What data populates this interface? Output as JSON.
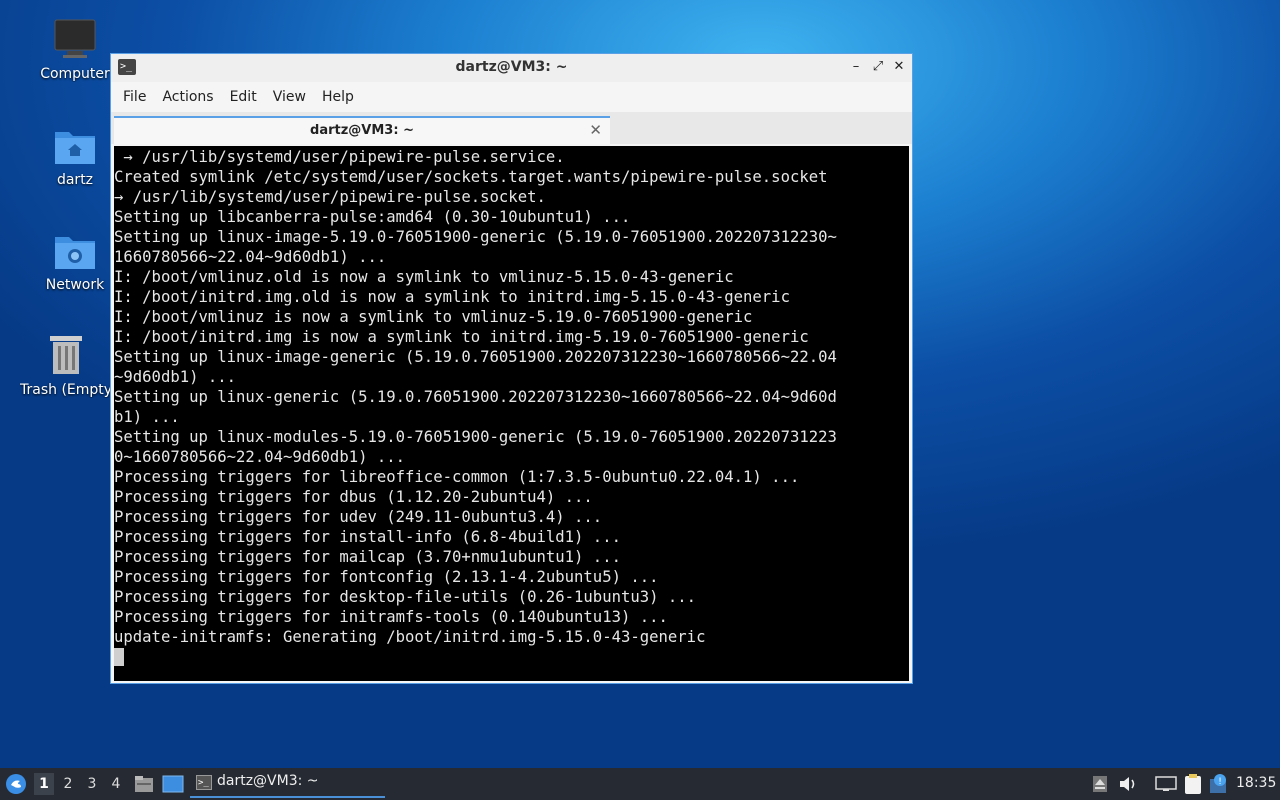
{
  "desktop": {
    "icons": [
      {
        "label": "Computer",
        "icon": "monitor-icon"
      },
      {
        "label": "dartz",
        "icon": "home-folder-icon"
      },
      {
        "label": "Network",
        "icon": "network-folder-icon"
      },
      {
        "label": "Trash (Empty)",
        "icon": "trash-icon"
      }
    ]
  },
  "window": {
    "title": "dartz@VM3: ~",
    "menu": [
      "File",
      "Actions",
      "Edit",
      "View",
      "Help"
    ],
    "tab_label": "dartz@VM3: ~",
    "terminal_lines": [
      " → /usr/lib/systemd/user/pipewire-pulse.service.",
      "Created symlink /etc/systemd/user/sockets.target.wants/pipewire-pulse.socket",
      "→ /usr/lib/systemd/user/pipewire-pulse.socket.",
      "Setting up libcanberra-pulse:amd64 (0.30-10ubuntu1) ...",
      "Setting up linux-image-5.19.0-76051900-generic (5.19.0-76051900.202207312230~",
      "1660780566~22.04~9d60db1) ...",
      "I: /boot/vmlinuz.old is now a symlink to vmlinuz-5.15.0-43-generic",
      "I: /boot/initrd.img.old is now a symlink to initrd.img-5.15.0-43-generic",
      "I: /boot/vmlinuz is now a symlink to vmlinuz-5.19.0-76051900-generic",
      "I: /boot/initrd.img is now a symlink to initrd.img-5.19.0-76051900-generic",
      "Setting up linux-image-generic (5.19.0.76051900.202207312230~1660780566~22.04",
      "~9d60db1) ...",
      "Setting up linux-generic (5.19.0.76051900.202207312230~1660780566~22.04~9d60d",
      "b1) ...",
      "Setting up linux-modules-5.19.0-76051900-generic (5.19.0-76051900.20220731223",
      "0~1660780566~22.04~9d60db1) ...",
      "Processing triggers for libreoffice-common (1:7.3.5-0ubuntu0.22.04.1) ...",
      "Processing triggers for dbus (1.12.20-2ubuntu4) ...",
      "Processing triggers for udev (249.11-0ubuntu3.4) ...",
      "Processing triggers for install-info (6.8-4build1) ...",
      "Processing triggers for mailcap (3.70+nmu1ubuntu1) ...",
      "Processing triggers for fontconfig (2.13.1-4.2ubuntu5) ...",
      "Processing triggers for desktop-file-utils (0.26-1ubuntu3) ...",
      "Processing triggers for initramfs-tools (0.140ubuntu13) ...",
      "update-initramfs: Generating /boot/initrd.img-5.15.0-43-generic"
    ]
  },
  "taskbar": {
    "workspaces": [
      "1",
      "2",
      "3",
      "4"
    ],
    "active_workspace": "1",
    "task_label": "dartz@VM3: ~",
    "clock": "18:35"
  }
}
